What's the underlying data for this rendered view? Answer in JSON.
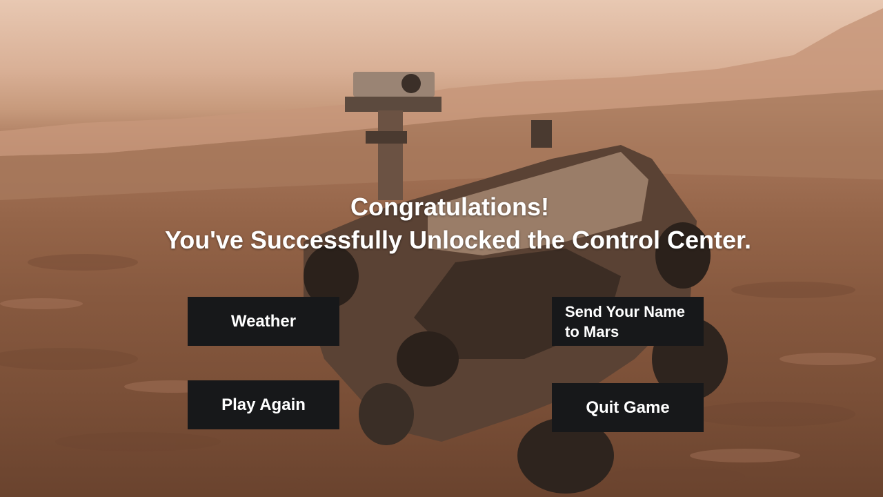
{
  "screen": {
    "title_line1": "Congratulations!",
    "title_line2": "You've Successfully Unlocked the Control Center."
  },
  "buttons": {
    "weather": "Weather",
    "send_name": "Send Your Name to Mars",
    "play_again": "Play Again",
    "quit": "Quit Game"
  },
  "colors": {
    "sky": "#e8c8b2",
    "ground": "#8a5c42",
    "button_bg": "#17181a",
    "button_text": "#ffffff"
  }
}
